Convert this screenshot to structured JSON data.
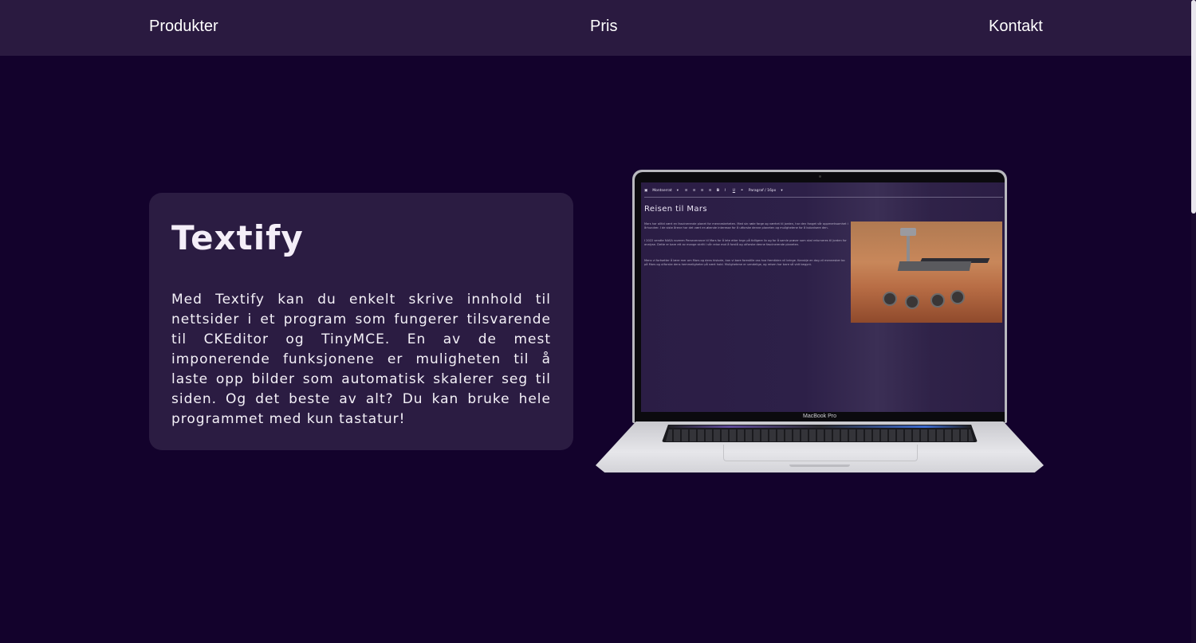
{
  "nav": {
    "items": [
      {
        "label": "Produkter"
      },
      {
        "label": "Pris"
      },
      {
        "label": "Kontakt"
      }
    ]
  },
  "hero": {
    "title": "Textify",
    "description": "Med Textify kan du enkelt skrive innhold til nettsider i et program som fungerer tilsvarende til CKEditor og TinyMCE. En av de mest imponerende funksjonene er muligheten til å laste opp bilder som automatisk skalerer seg til siden. Og det beste av alt? Du kan bruke hele programmet med kun tastatur!"
  },
  "laptop": {
    "brand_label": "MacBook Pro",
    "editor": {
      "toolbar": {
        "font": "Montserrat",
        "align_left": "≡",
        "align_center": "≡",
        "align_right": "≡",
        "align_justify": "≡",
        "bold": "B",
        "italic": "I",
        "underline": "U",
        "paragraph": "Paragraf / 16px"
      },
      "doc_title": "Reisen til Mars",
      "paragraphs": [
        "Mars har alltid vært en fascinerende planet for menneskeheten. Med sin røde farge og nærhet til jorden, har den fanget vår oppmerksomhet i århundrer. I de siste årene har det vært en økende interesse for å utforske denne planeten og mulighetene for å kolonisere den.",
        "I 2022 sendte NASA roveren Perseverance til Mars for å lete etter tegn på tidligere liv og for å samle prøver som skal returneres til Jorden for analyse. Dette er bare ett av mange skritt i vår reise mot å forstå og utforske denne fascinerende planeten.",
        "Mens vi fortsetter å lære mer om Mars og dens historie, kan vi bare forestille oss hva fremtiden vil bringe. Kanskje en dag vil mennesker bo på Mars og utforske dens hemmeligheter på nært hold. Mulighetene er uendelige, og reisen har bare så vidt begynt."
      ]
    }
  },
  "colors": {
    "background": "#13022c",
    "nav_background": "#2a1a40",
    "card_background": "#2b1c42",
    "text": "#ffffff"
  }
}
